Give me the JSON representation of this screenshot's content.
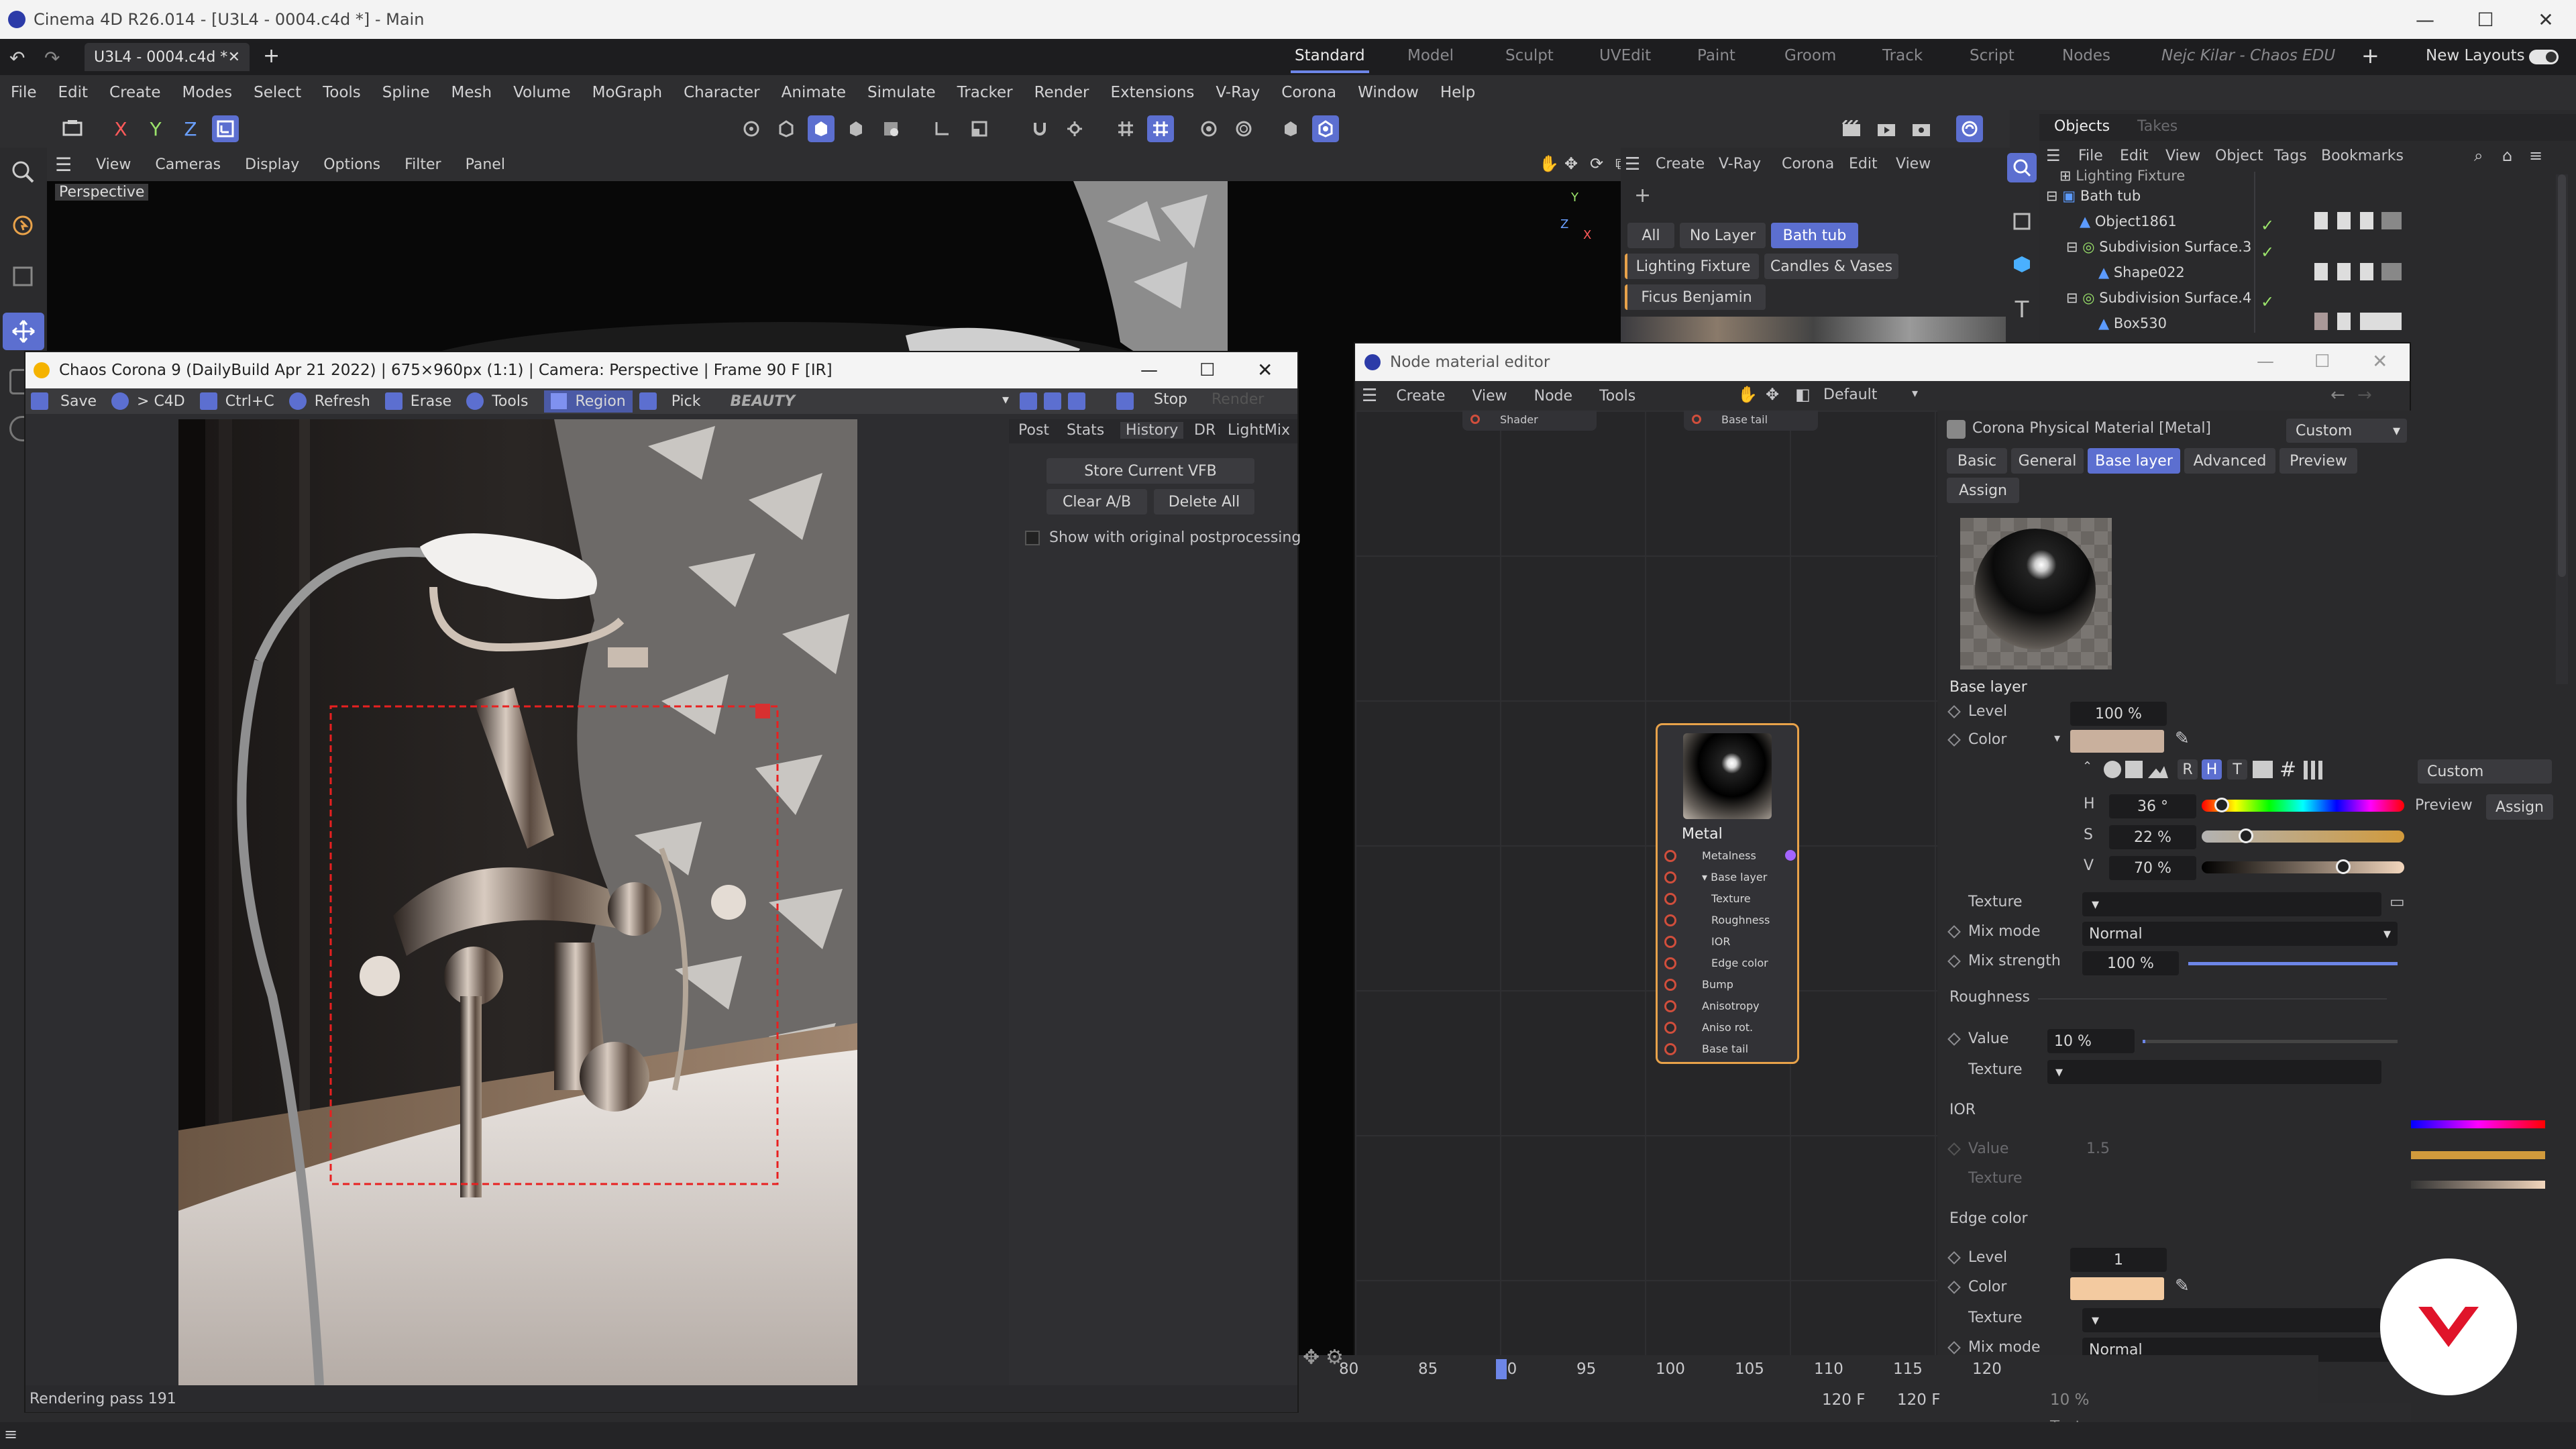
{
  "os_window": {
    "title": "Cinema 4D R26.014 - [U3L4 - 0004.c4d *] - Main"
  },
  "tabbar": {
    "doc_tab": "U3L4 - 0004.c4d *",
    "layouts": [
      "Standard",
      "Model",
      "Sculpt",
      "UVEdit",
      "Paint",
      "Groom",
      "Track",
      "Script",
      "Nodes"
    ],
    "user": "Nejc Kilar - Chaos EDU",
    "new_layouts": "New Layouts"
  },
  "main_menu": [
    "File",
    "Edit",
    "Create",
    "Modes",
    "Select",
    "Tools",
    "Spline",
    "Mesh",
    "Volume",
    "MoGraph",
    "Character",
    "Animate",
    "Simulate",
    "Tracker",
    "Render",
    "Extensions",
    "V-Ray",
    "Corona",
    "Window",
    "Help"
  ],
  "viewport": {
    "menu": [
      "View",
      "Cameras",
      "Display",
      "Options",
      "Filter",
      "Panel"
    ],
    "label": "Perspective",
    "axis_y": "Y",
    "axis_z": "Z",
    "axis_x": "X"
  },
  "create_panel": {
    "menu": [
      "Create",
      "V-Ray",
      "Corona",
      "Edit",
      "View"
    ],
    "filters": [
      "All",
      "No Layer",
      "Bath tub",
      "Lighting Fixture",
      "Candles & Vases",
      "Ficus Benjamin"
    ]
  },
  "objects": {
    "tabs": [
      "Objects",
      "Takes"
    ],
    "menu": [
      "File",
      "Edit",
      "View",
      "Object",
      "Tags",
      "Bookmarks"
    ],
    "rows": [
      {
        "name": "Lighting Fixture",
        "indent": 0
      },
      {
        "name": "Bath tub",
        "indent": 0
      },
      {
        "name": "Object1861",
        "indent": 1
      },
      {
        "name": "Subdivision Surface.3",
        "indent": 1
      },
      {
        "name": "Shape022",
        "indent": 2
      },
      {
        "name": "Subdivision Surface.4",
        "indent": 1
      },
      {
        "name": "Box530",
        "indent": 2
      }
    ]
  },
  "vfb": {
    "title": "Chaos Corona 9 (DailyBuild Apr 21 2022) | 675×960px (1:1) | Camera: Perspective | Frame 90 F [IR]",
    "toolbar": {
      "save": "Save",
      "c4d": "> C4D",
      "copy": "Ctrl+C",
      "refresh": "Refresh",
      "erase": "Erase",
      "tools": "Tools",
      "region": "Region",
      "pick": "Pick",
      "pass": "BEAUTY",
      "stop": "Stop",
      "render": "Render"
    },
    "side_tabs": [
      "Post",
      "Stats",
      "History",
      "DR",
      "LightMix"
    ],
    "store": "Store Current VFB",
    "clear": "Clear A/B",
    "delete": "Delete All",
    "show_orig": "Show with original postprocessing",
    "status": "Rendering pass 191"
  },
  "nme": {
    "title": "Node material editor",
    "menu": [
      "Create",
      "View",
      "Node",
      "Tools"
    ],
    "preset": "Default",
    "top_ports": [
      "Shader",
      "Base tail"
    ],
    "node": {
      "title": "Metal",
      "ports": [
        "Metalness",
        "Base layer",
        "Texture",
        "Roughness",
        "IOR",
        "Edge color",
        "Bump",
        "Anisotropy",
        "Aniso rot.",
        "Base tail"
      ]
    },
    "attr": {
      "material": "Corona Physical Material [Metal]",
      "mode": "Custom",
      "tabs": [
        "Basic",
        "General",
        "Base layer",
        "Advanced",
        "Preview"
      ],
      "assign": "Assign",
      "section_base": "Base layer",
      "level_label": "Level",
      "level": "100 %",
      "color_label": "Color",
      "color_hex": "#c9b09d",
      "hsv": {
        "h_label": "H",
        "h": "36 °",
        "s_label": "S",
        "s": "22 %",
        "v_label": "V",
        "v": "70 %"
      },
      "hsv_modes": [
        "R",
        "H",
        "T"
      ],
      "texture_label": "Texture",
      "mix_mode_label": "Mix mode",
      "mix_mode": "Normal",
      "mix_strength_label": "Mix strength",
      "mix_strength": "100 %",
      "section_rough": "Roughness",
      "value_label": "Value",
      "rough_value": "10 %",
      "section_ior": "IOR",
      "ior_value": "1.5",
      "section_edge": "Edge color",
      "edge_level": "1",
      "edge_color_hex": "#f3caa0",
      "edge_mix_mode": "Normal"
    }
  },
  "right_extra": {
    "mode": "Custom",
    "preview": "Preview",
    "assign": "Assign",
    "value": "10 %",
    "texture": "Texture"
  },
  "timeline": {
    "ticks": [
      "80",
      "85",
      "90",
      "95",
      "100",
      "105",
      "110",
      "115",
      "120"
    ],
    "end1": "120 F",
    "end2": "120 F"
  }
}
